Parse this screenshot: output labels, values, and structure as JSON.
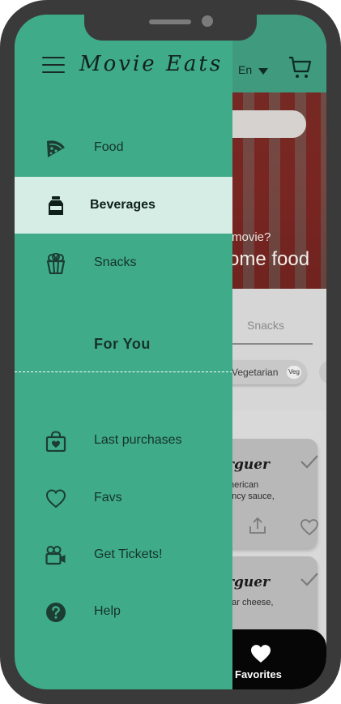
{
  "app": {
    "language": "En",
    "hero_question": "movie?",
    "hero_title": "ome food",
    "tab_visible": "Snacks",
    "chip_label": "Vegetarian",
    "chip_badge": "Veg",
    "cards": [
      {
        "name": "rguer",
        "description": "merican\nancy sauce,"
      },
      {
        "name": "rguer",
        "description": "dar cheese,"
      }
    ],
    "bottom_nav": {
      "favorites_label": "Favorites"
    }
  },
  "drawer": {
    "logo": "Movie Eats",
    "items": [
      {
        "label": "Food",
        "icon": "pizza-slice-icon"
      },
      {
        "label": "Beverages",
        "icon": "bottle-icon",
        "active": true
      },
      {
        "label": "Snacks",
        "icon": "popcorn-icon"
      }
    ],
    "section_title": "For You",
    "personal_items": [
      {
        "label": "Last purchases",
        "icon": "shopping-bag-heart-icon"
      },
      {
        "label": "Favs",
        "icon": "heart-icon"
      },
      {
        "label": "Get Tickets!",
        "icon": "video-camera-icon"
      },
      {
        "label": "Help",
        "icon": "question-circle-icon"
      }
    ]
  },
  "colors": {
    "drawer_bg": "#3fab88",
    "active_item_bg": "#d6ede6",
    "header_bg": "#3f9a7e",
    "bottom_bar_bg": "#060606",
    "frame": "#3a3a3a"
  }
}
